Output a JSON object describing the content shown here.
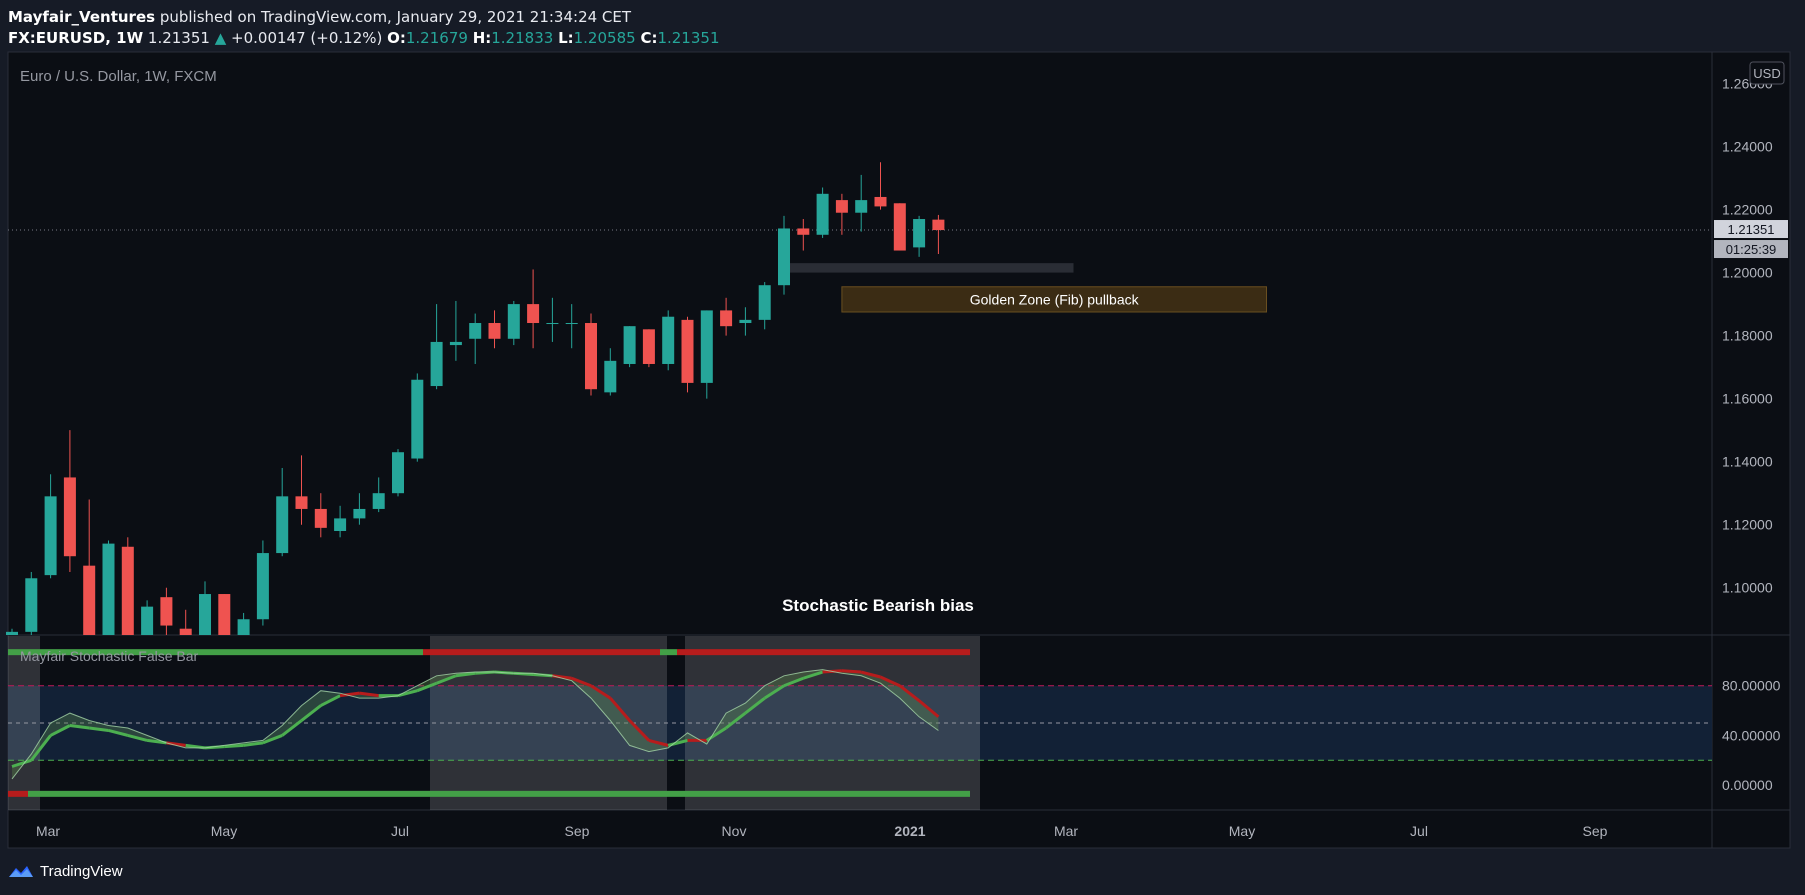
{
  "header": {
    "author": "Mayfair_Ventures",
    "published_text": "published on TradingView.com, January 29, 2021 21:34:24 CET"
  },
  "ohlc": {
    "symbol": "FX:EURUSD, 1W",
    "last": "1.21351",
    "change": "+0.00147 (+0.12%)",
    "o_label": "O:",
    "o": "1.21679",
    "h_label": "H:",
    "h": "1.21833",
    "l_label": "L:",
    "l": "1.20585",
    "c_label": "C:",
    "c": "1.21351"
  },
  "chart_data": [
    {
      "type": "candlestick",
      "title": "Euro / U.S. Dollar, 1W, FXCM",
      "currency": "USD",
      "y_ticks": [
        "1.26000",
        "1.24000",
        "1.22000",
        "1.20000",
        "1.18000",
        "1.16000",
        "1.14000",
        "1.12000",
        "1.10000"
      ],
      "ylim": [
        1.085,
        1.27
      ],
      "last_price_label": "1.21351",
      "countdown_label": "01:25:39",
      "x_ticks": [
        "Mar",
        "May",
        "Jul",
        "Sep",
        "Nov",
        "2021",
        "Mar",
        "May",
        "Jul",
        "Sep"
      ],
      "candles": [
        {
          "o": 1.084,
          "h": 1.087,
          "l": 1.083,
          "c": 1.086
        },
        {
          "o": 1.086,
          "h": 1.105,
          "l": 1.085,
          "c": 1.103
        },
        {
          "o": 1.104,
          "h": 1.136,
          "l": 1.103,
          "c": 1.129
        },
        {
          "o": 1.135,
          "h": 1.15,
          "l": 1.105,
          "c": 1.11
        },
        {
          "o": 1.107,
          "h": 1.128,
          "l": 1.08,
          "c": 1.085
        },
        {
          "o": 1.084,
          "h": 1.115,
          "l": 1.078,
          "c": 1.114
        },
        {
          "o": 1.113,
          "h": 1.116,
          "l": 1.078,
          "c": 1.078
        },
        {
          "o": 1.085,
          "h": 1.096,
          "l": 1.082,
          "c": 1.094
        },
        {
          "o": 1.097,
          "h": 1.1,
          "l": 1.085,
          "c": 1.088
        },
        {
          "o": 1.087,
          "h": 1.093,
          "l": 1.078,
          "c": 1.084
        },
        {
          "o": 1.084,
          "h": 1.102,
          "l": 1.08,
          "c": 1.098
        },
        {
          "o": 1.098,
          "h": 1.098,
          "l": 1.076,
          "c": 1.078
        },
        {
          "o": 1.084,
          "h": 1.092,
          "l": 1.078,
          "c": 1.09
        },
        {
          "o": 1.09,
          "h": 1.115,
          "l": 1.088,
          "c": 1.111
        },
        {
          "o": 1.111,
          "h": 1.138,
          "l": 1.11,
          "c": 1.129
        },
        {
          "o": 1.129,
          "h": 1.142,
          "l": 1.12,
          "c": 1.125
        },
        {
          "o": 1.125,
          "h": 1.13,
          "l": 1.116,
          "c": 1.119
        },
        {
          "o": 1.118,
          "h": 1.126,
          "l": 1.116,
          "c": 1.122
        },
        {
          "o": 1.122,
          "h": 1.13,
          "l": 1.12,
          "c": 1.125
        },
        {
          "o": 1.125,
          "h": 1.135,
          "l": 1.124,
          "c": 1.13
        },
        {
          "o": 1.13,
          "h": 1.144,
          "l": 1.129,
          "c": 1.143
        },
        {
          "o": 1.141,
          "h": 1.168,
          "l": 1.14,
          "c": 1.166
        },
        {
          "o": 1.164,
          "h": 1.19,
          "l": 1.163,
          "c": 1.178
        },
        {
          "o": 1.177,
          "h": 1.191,
          "l": 1.172,
          "c": 1.178
        },
        {
          "o": 1.179,
          "h": 1.187,
          "l": 1.171,
          "c": 1.184
        },
        {
          "o": 1.184,
          "h": 1.188,
          "l": 1.176,
          "c": 1.179
        },
        {
          "o": 1.179,
          "h": 1.191,
          "l": 1.177,
          "c": 1.19
        },
        {
          "o": 1.19,
          "h": 1.201,
          "l": 1.176,
          "c": 1.184
        },
        {
          "o": 1.184,
          "h": 1.192,
          "l": 1.178,
          "c": 1.184
        },
        {
          "o": 1.184,
          "h": 1.19,
          "l": 1.176,
          "c": 1.184
        },
        {
          "o": 1.184,
          "h": 1.187,
          "l": 1.161,
          "c": 1.163
        },
        {
          "o": 1.162,
          "h": 1.176,
          "l": 1.161,
          "c": 1.172
        },
        {
          "o": 1.171,
          "h": 1.183,
          "l": 1.17,
          "c": 1.183
        },
        {
          "o": 1.182,
          "h": 1.182,
          "l": 1.17,
          "c": 1.171
        },
        {
          "o": 1.171,
          "h": 1.188,
          "l": 1.169,
          "c": 1.186
        },
        {
          "o": 1.185,
          "h": 1.186,
          "l": 1.162,
          "c": 1.165
        },
        {
          "o": 1.165,
          "h": 1.188,
          "l": 1.16,
          "c": 1.188
        },
        {
          "o": 1.188,
          "h": 1.192,
          "l": 1.18,
          "c": 1.183
        },
        {
          "o": 1.184,
          "h": 1.189,
          "l": 1.18,
          "c": 1.185
        },
        {
          "o": 1.185,
          "h": 1.197,
          "l": 1.182,
          "c": 1.196
        },
        {
          "o": 1.196,
          "h": 1.218,
          "l": 1.193,
          "c": 1.214
        },
        {
          "o": 1.214,
          "h": 1.217,
          "l": 1.207,
          "c": 1.212
        },
        {
          "o": 1.212,
          "h": 1.227,
          "l": 1.211,
          "c": 1.225
        },
        {
          "o": 1.223,
          "h": 1.225,
          "l": 1.212,
          "c": 1.219
        },
        {
          "o": 1.219,
          "h": 1.231,
          "l": 1.213,
          "c": 1.223
        },
        {
          "o": 1.224,
          "h": 1.235,
          "l": 1.22,
          "c": 1.221
        },
        {
          "o": 1.222,
          "h": 1.222,
          "l": 1.207,
          "c": 1.207
        },
        {
          "o": 1.208,
          "h": 1.218,
          "l": 1.205,
          "c": 1.217
        },
        {
          "o": 1.2168,
          "h": 1.2183,
          "l": 1.2059,
          "c": 1.2135
        }
      ],
      "annotations": {
        "fib_label": "Golden Zone (Fib) pullback",
        "fib_zone": {
          "from_index": 43,
          "to_index": 65,
          "y_top": 1.1955,
          "y_bottom": 1.1875
        },
        "support_zone": {
          "from_index": 40,
          "to_index": 55,
          "y_top": 1.203,
          "y_bottom": 1.2
        },
        "bias_label": "Stochastic Bearish bias"
      }
    },
    {
      "type": "line",
      "title": "Mayfair Stochastic False Bar",
      "y_ticks": [
        "80.00000",
        "40.00000",
        "0.00000"
      ],
      "ylim": [
        -20,
        120
      ],
      "levels": {
        "upper": 80,
        "middle": 50,
        "lower": 20
      },
      "series": [
        {
          "values": [
            5,
            25,
            50,
            58,
            52,
            48,
            46,
            40,
            34,
            30,
            30,
            32,
            34,
            36,
            48,
            64,
            76,
            74,
            70,
            70,
            72,
            80,
            88,
            90,
            91,
            91,
            90,
            90,
            88,
            84,
            70,
            52,
            32,
            27,
            30,
            42,
            33,
            58,
            66,
            80,
            88,
            91,
            93,
            90,
            88,
            82,
            70,
            55,
            44
          ]
        },
        {
          "values": [
            15,
            20,
            40,
            48,
            46,
            44,
            40,
            36,
            34,
            32,
            30,
            31,
            32,
            34,
            40,
            52,
            64,
            72,
            74,
            72,
            72,
            76,
            82,
            88,
            90,
            91,
            90,
            89,
            88,
            86,
            80,
            70,
            52,
            36,
            32,
            36,
            36,
            46,
            58,
            70,
            80,
            86,
            91,
            92,
            91,
            87,
            80,
            68,
            55
          ]
        }
      ]
    }
  ]
}
